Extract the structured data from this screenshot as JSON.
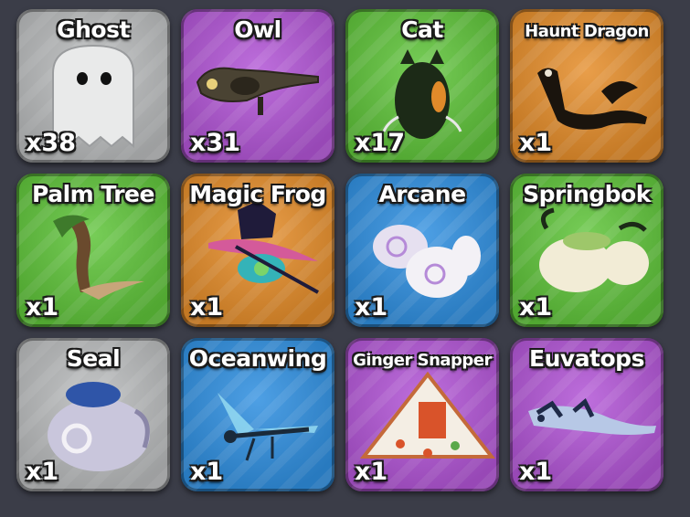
{
  "pets": [
    {
      "name": "Ghost",
      "count": "x38",
      "rarity_color": "#b9bbbc",
      "icon": "ghost-pet-icon"
    },
    {
      "name": "Owl",
      "count": "x31",
      "rarity_color": "#b255d6",
      "icon": "owl-pet-icon"
    },
    {
      "name": "Cat",
      "count": "x17",
      "rarity_color": "#5fc43a",
      "icon": "cat-pet-icon"
    },
    {
      "name": "Haunt Dragon",
      "count": "x1",
      "rarity_color": "#e58d2a",
      "icon": "haunt-dragon-pet-icon"
    },
    {
      "name": "Palm Tree",
      "count": "x1",
      "rarity_color": "#5fc43a",
      "icon": "palm-tree-pet-icon"
    },
    {
      "name": "Magic Frog",
      "count": "x1",
      "rarity_color": "#e58d2a",
      "icon": "magic-frog-pet-icon"
    },
    {
      "name": "Arcane",
      "count": "x1",
      "rarity_color": "#2f8fe0",
      "icon": "arcane-pet-icon"
    },
    {
      "name": "Springbok",
      "count": "x1",
      "rarity_color": "#5fc43a",
      "icon": "springbok-pet-icon"
    },
    {
      "name": "Seal",
      "count": "x1",
      "rarity_color": "#b9bbbc",
      "icon": "seal-pet-icon"
    },
    {
      "name": "Oceanwing",
      "count": "x1",
      "rarity_color": "#2f8fe0",
      "icon": "oceanwing-pet-icon"
    },
    {
      "name": "Ginger Snapper",
      "count": "x1",
      "rarity_color": "#b255d6",
      "icon": "ginger-snapper-pet-icon"
    },
    {
      "name": "Euvatops",
      "count": "x1",
      "rarity_color": "#b255d6",
      "icon": "euvatops-pet-icon"
    }
  ]
}
